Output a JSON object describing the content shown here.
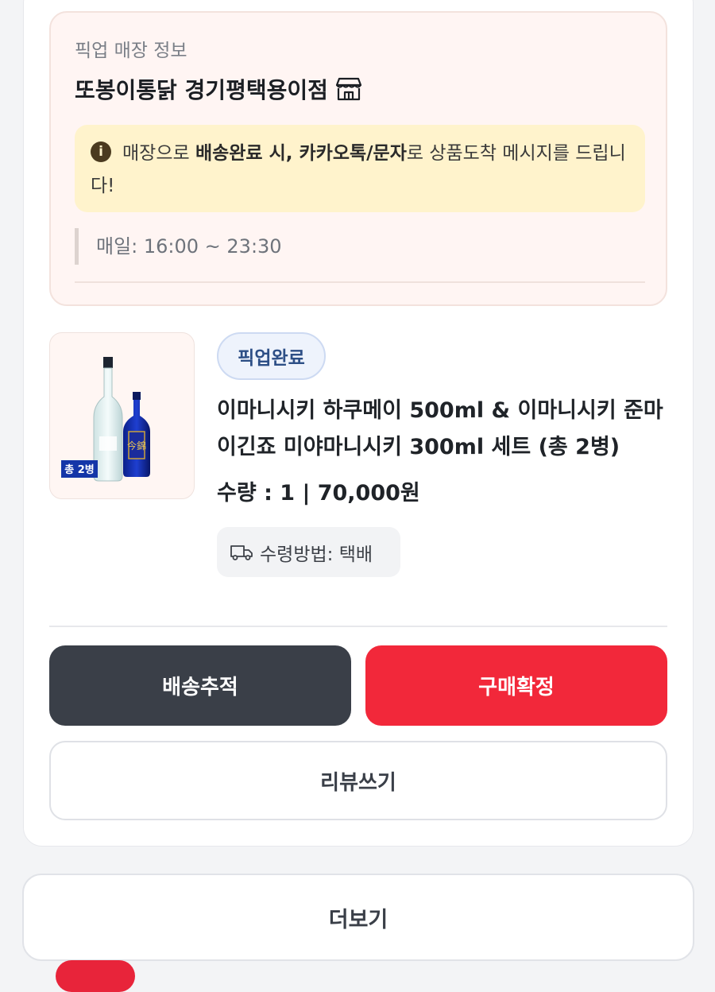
{
  "pickup": {
    "section_label": "픽업 매장 정보",
    "store_name": "또봉이통닭 경기평택용이점",
    "notice": {
      "part1": "매장으로 ",
      "part2": "배송완료 시, 카카오톡/문자",
      "part3": "로 상품도착 메시지를 드립니다!"
    },
    "hours": "매일: 16:00 ~ 23:30"
  },
  "product": {
    "thumbnail_badge": "총 2병",
    "status": "픽업완료",
    "name": "이마니시키 하쿠메이 500ml & 이마니시키 준마이긴죠 미야마니시키 300ml 세트 (총 2병)",
    "qty_price": "수량 : 1 | 70,000원",
    "receive_method": "수령방법: 택배"
  },
  "actions": {
    "track": "배송추적",
    "confirm": "구매확정",
    "review": "리뷰쓰기",
    "more": "더보기"
  },
  "colors": {
    "confirm_red": "#f2283a",
    "track_dark": "#3a3f48",
    "badge_blue": "#2d4f86",
    "notice_yellow": "#fff3cc",
    "pickup_bg": "#fff5f3"
  }
}
